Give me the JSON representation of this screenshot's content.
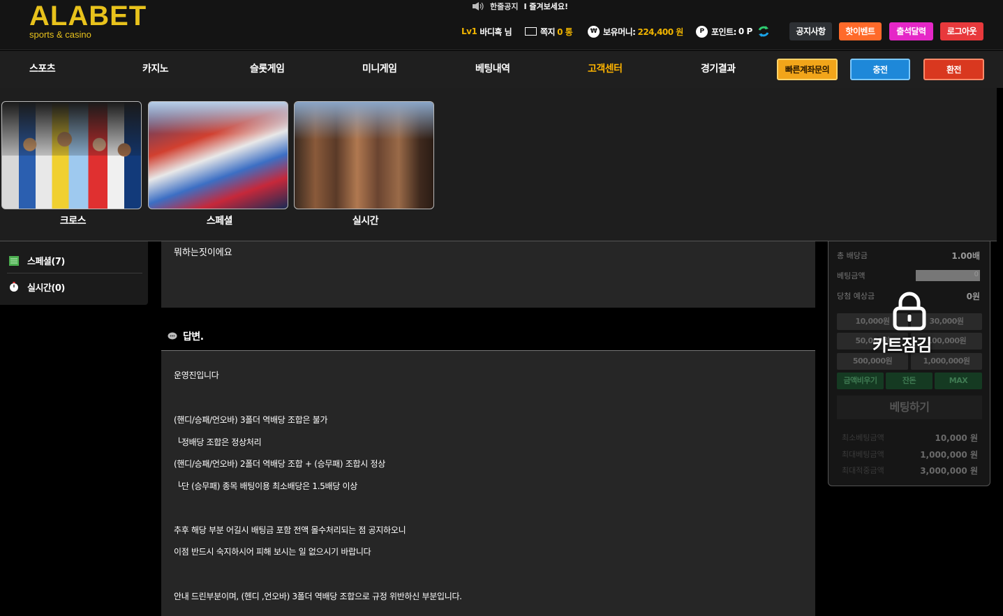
{
  "logo": {
    "main": "ALABET",
    "sub": "sports & casino"
  },
  "notice": {
    "label": "한줄공지",
    "ticker": "I 즐겨보세요!"
  },
  "user": {
    "level": "Lv1",
    "name": "바디흑 님",
    "msg_label": "쪽지",
    "msg_count": "0 통",
    "money_label": "보유머니:",
    "money_value": "224,400 원",
    "point_label": "포인트:",
    "point_value": "0 P"
  },
  "top_buttons": {
    "notice": "공지사항",
    "event": "핫이벤트",
    "attend": "출석달력",
    "logout": "로그아웃"
  },
  "nav": {
    "items": [
      "스포츠",
      "카지노",
      "슬롯게임",
      "미니게임",
      "베팅내역",
      "고객센터",
      "경기결과"
    ],
    "active": "고객센터",
    "fast_account": "빠른계좌문의",
    "charge": "충전",
    "exchange": "환전"
  },
  "dropdown": {
    "cards": [
      "크로스",
      "스페셜",
      "실시간"
    ]
  },
  "sidebar": {
    "items": [
      "스페셜(7)",
      "실시간(0)"
    ]
  },
  "question": {
    "text": "뭐하는짓이에요"
  },
  "answer": {
    "title": "답변.",
    "lines": [
      "운영진입니다",
      "(핸디/승패/언오바) 3폴더 역배당 조합은 불가",
      "└정배당 조합은 정상처리",
      "(핸디/승패/언오바) 2폴더 역배당 조합 + (승무패) 조합시 정상",
      "└단 (승무패) 종목 배팅이용 최소배당은 1.5배당 이상",
      "추후 해당 부분 어길시 배팅금 포함 전액 몰수처리되는 점 공지하오니",
      "이점 반드시 숙지하시어 피해 보시는 일 없으시기 바랍니다",
      "안내 드린부분이며, (헨디 ,언오바) 3폴더 역배당 조합으로 규정 위반하신 부분입니다."
    ]
  },
  "betslip": {
    "total_odds_label": "총 배당금",
    "total_odds_value": "1.00배",
    "bet_amount_label": "베팅금액",
    "bet_amount_value": "0",
    "expected_label": "당첨 예상금",
    "expected_value": "0원",
    "chips": [
      "10,000원",
      "30,000원",
      "50,000원",
      "100,000원",
      "500,000원",
      "1,000,000원"
    ],
    "actions": [
      "금액비우기",
      "잔돈",
      "MAX"
    ],
    "bet_button": "베팅하기",
    "min_label": "최소베팅금액",
    "min_value": "10,000 원",
    "max_label": "최대베팅금액",
    "max_value": "1,000,000 원",
    "maxwin_label": "최대적중금액",
    "maxwin_value": "3,000,000 원",
    "lock_text": "카트잠김"
  },
  "colors": {
    "gold": "#e8c21c",
    "accent": "#ffb400",
    "bg": "#000000"
  }
}
